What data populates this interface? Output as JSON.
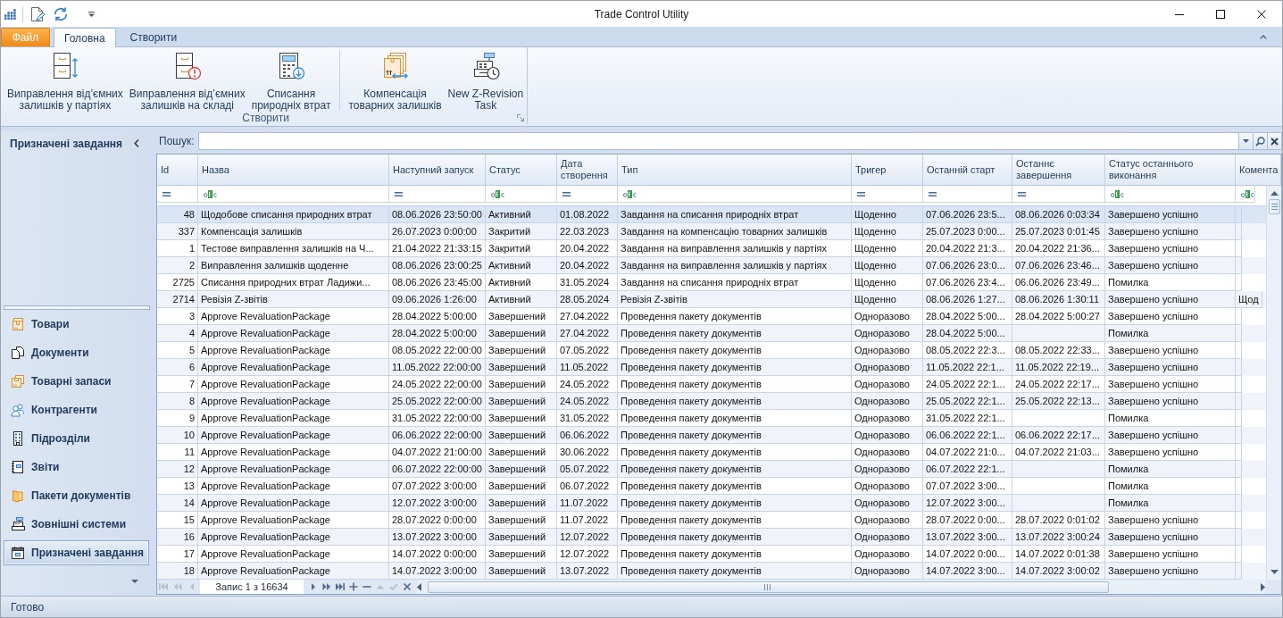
{
  "window": {
    "title": "Trade Control Utility"
  },
  "ribbon": {
    "tabs": [
      {
        "label": "Файл",
        "kind": "menu",
        "selected": false
      },
      {
        "label": "Головна",
        "kind": "tab",
        "selected": true
      },
      {
        "label": "Створити",
        "kind": "tab",
        "selected": false
      }
    ],
    "groups": [
      {
        "label": "Створити",
        "sections": [
          {
            "buttons": [
              {
                "label": "Виправлення відʼємних\nзалишків у партіях"
              },
              {
                "label": "Виправлення відʼємних\nзалишків на складі"
              },
              {
                "label": "Списання\nприродніх втрат"
              }
            ]
          },
          {
            "buttons": [
              {
                "label": "Компенсація\nтоварних залишків"
              },
              {
                "label": "New Z-Revision\nTask"
              }
            ]
          }
        ]
      }
    ]
  },
  "sidebar": {
    "title": "Призначені завдання",
    "items": [
      {
        "label": "Товари",
        "selected": false
      },
      {
        "label": "Документи",
        "selected": false
      },
      {
        "label": "Товарні запаси",
        "selected": false
      },
      {
        "label": "Контрагенти",
        "selected": false
      },
      {
        "label": "Підрозділи",
        "selected": false
      },
      {
        "label": "Звіти",
        "selected": false
      },
      {
        "label": "Пакети документів",
        "selected": false
      },
      {
        "label": "Зовнішні системи",
        "selected": false
      },
      {
        "label": "Призначені завдання",
        "selected": true
      }
    ]
  },
  "search": {
    "label": "Пошук:"
  },
  "table": {
    "columns": [
      {
        "label": "Id",
        "kind": "equals"
      },
      {
        "label": "Назва",
        "kind": "text"
      },
      {
        "label": "Наступний запуск",
        "kind": "equals"
      },
      {
        "label": "Статус",
        "kind": "text"
      },
      {
        "label": "Дата створення",
        "kind": "equals"
      },
      {
        "label": "Тип",
        "kind": "text"
      },
      {
        "label": "Тригер",
        "kind": "equals"
      },
      {
        "label": "Останній старт",
        "kind": "equals"
      },
      {
        "label": "Останнє завершення",
        "kind": "equals"
      },
      {
        "label": "Статус останнього виконання",
        "kind": "text"
      },
      {
        "label": "Комента",
        "kind": "text"
      }
    ],
    "rows": [
      {
        "selected": true,
        "id": "48",
        "name": "Щодобове списання природних втрат",
        "next_run": "08.06.2026 23:50:00",
        "status": "Активний",
        "created": "01.08.2022",
        "type": "Завдання на списання природніх втрат",
        "trigger": "Щоденно",
        "last_start": "07.06.2026 23:5...",
        "last_finish": "08.06.2026 0:03:34",
        "last_run_status": "Завершено успішно"
      },
      {
        "selected": false,
        "id": "337",
        "name": "Компенсація залишків",
        "next_run": "26.07.2023 0:00:00",
        "status": "Закритий",
        "created": "22.03.2023",
        "type": "Завдання на компенсацію товарних залишків",
        "trigger": "Щоденно",
        "last_start": "25.07.2023 0:00...",
        "last_finish": "25.07.2023 0:01:45",
        "last_run_status": "Завершено успішно"
      },
      {
        "selected": false,
        "id": "1",
        "name": "Тестове виправлення залишків на Ч...",
        "next_run": "21.04.2022 21:33:15",
        "status": "Закритий",
        "created": "20.04.2022",
        "type": "Завдання на виправлення залишків у партіях",
        "trigger": "Щоденно",
        "last_start": "20.04.2022 21:3...",
        "last_finish": "20.04.2022 21:36...",
        "last_run_status": "Завершено успішно"
      },
      {
        "selected": false,
        "id": "2",
        "name": "Виправлення залишків щоденне",
        "next_run": "08.06.2026 23:00:25",
        "status": "Активний",
        "created": "20.04.2022",
        "type": "Завдання на виправлення залишків у партіях",
        "trigger": "Щоденно",
        "last_start": "07.06.2026 23:0...",
        "last_finish": "07.06.2026 23:46...",
        "last_run_status": "Завершено успішно"
      },
      {
        "selected": false,
        "id": "2725",
        "name": "Списання природних втрат Ладижи...",
        "next_run": "08.06.2026 23:45:00",
        "status": "Активний",
        "created": "31.05.2024",
        "type": "Завдання на списання природніх втрат",
        "trigger": "Щоденно",
        "last_start": "07.06.2026 23:4...",
        "last_finish": "06.06.2026 23:49...",
        "last_run_status": "Помилка"
      },
      {
        "selected": false,
        "id": "2714",
        "name": "Ревізія Z-звітів",
        "next_run": "09.06.2026 1:26:00",
        "status": "Активний",
        "created": "28.05.2024",
        "type": "Ревізія Z-звітів",
        "trigger": "Щоденно",
        "last_start": "08.06.2026 1:27...",
        "last_finish": "08.06.2026 1:30:11",
        "last_run_status": "Завершено успішно",
        "column_11": "Щод"
      },
      {
        "selected": false,
        "id": "3",
        "name": "Approve RevaluationPackage",
        "next_run": "28.04.2022 5:00:00",
        "status": "Завершений",
        "created": "27.04.2022",
        "type": "Проведення пакету документів",
        "trigger": "Одноразово",
        "last_start": "28.04.2022 5:00...",
        "last_finish": "28.04.2022 5:00:27",
        "last_run_status": "Завершено успішно"
      },
      {
        "selected": false,
        "id": "4",
        "name": "Approve RevaluationPackage",
        "next_run": "28.04.2022 5:00:00",
        "status": "Завершений",
        "created": "27.04.2022",
        "type": "Проведення пакету документів",
        "trigger": "Одноразово",
        "last_start": "28.04.2022 5:00...",
        "last_run_status": "Помилка"
      },
      {
        "selected": false,
        "id": "5",
        "name": "Approve RevaluationPackage",
        "next_run": "08.05.2022 22:00:00",
        "status": "Завершений",
        "created": "07.05.2022",
        "type": "Проведення пакету документів",
        "trigger": "Одноразово",
        "last_start": "08.05.2022 22:3...",
        "last_finish": "08.05.2022 22:33...",
        "last_run_status": "Завершено успішно"
      },
      {
        "selected": false,
        "id": "6",
        "name": "Approve RevaluationPackage",
        "next_run": "11.05.2022 22:00:00",
        "status": "Завершений",
        "created": "11.05.2022",
        "type": "Проведення пакету документів",
        "trigger": "Одноразово",
        "last_start": "11.05.2022 22:1...",
        "last_finish": "11.05.2022 22:19...",
        "last_run_status": "Завершено успішно"
      },
      {
        "selected": false,
        "id": "7",
        "name": "Approve RevaluationPackage",
        "next_run": "24.05.2022 22:00:00",
        "status": "Завершений",
        "created": "24.05.2022",
        "type": "Проведення пакету документів",
        "trigger": "Одноразово",
        "last_start": "24.05.2022 22:1...",
        "last_finish": "24.05.2022 22:17...",
        "last_run_status": "Завершено успішно"
      },
      {
        "selected": false,
        "id": "8",
        "name": "Approve RevaluationPackage",
        "next_run": "25.05.2022 22:00:00",
        "status": "Завершений",
        "created": "24.05.2022",
        "type": "Проведення пакету документів",
        "trigger": "Одноразово",
        "last_start": "25.05.2022 22:1...",
        "last_finish": "25.05.2022 22:13...",
        "last_run_status": "Завершено успішно"
      },
      {
        "selected": false,
        "id": "9",
        "name": "Approve RevaluationPackage",
        "next_run": "31.05.2022 22:00:00",
        "status": "Завершений",
        "created": "31.05.2022",
        "type": "Проведення пакету документів",
        "trigger": "Одноразово",
        "last_start": "31.05.2022 22:1...",
        "last_run_status": "Помилка"
      },
      {
        "selected": false,
        "id": "10",
        "name": "Approve RevaluationPackage",
        "next_run": "06.06.2022 22:00:00",
        "status": "Завершений",
        "created": "06.06.2022",
        "type": "Проведення пакету документів",
        "trigger": "Одноразово",
        "last_start": "06.06.2022 22:1...",
        "last_finish": "06.06.2022 22:17...",
        "last_run_status": "Завершено успішно"
      },
      {
        "selected": false,
        "id": "11",
        "name": "Approve RevaluationPackage",
        "next_run": "04.07.2022 21:00:00",
        "status": "Завершений",
        "created": "30.06.2022",
        "type": "Проведення пакету документів",
        "trigger": "Одноразово",
        "last_start": "04.07.2022 21:0...",
        "last_finish": "04.07.2022 21:03...",
        "last_run_status": "Завершено успішно"
      },
      {
        "selected": false,
        "id": "12",
        "name": "Approve RevaluationPackage",
        "next_run": "06.07.2022 22:00:00",
        "status": "Завершений",
        "created": "05.07.2022",
        "type": "Проведення пакету документів",
        "trigger": "Одноразово",
        "last_start": "06.07.2022 22:1...",
        "last_run_status": "Помилка"
      },
      {
        "selected": false,
        "id": "13",
        "name": "Approve RevaluationPackage",
        "next_run": "07.07.2022 3:00:00",
        "status": "Завершений",
        "created": "06.07.2022",
        "type": "Проведення пакету документів",
        "trigger": "Одноразово",
        "last_start": "07.07.2022 3:00...",
        "last_run_status": "Помилка"
      },
      {
        "selected": false,
        "id": "14",
        "name": "Approve RevaluationPackage",
        "next_run": "12.07.2022 3:00:00",
        "status": "Завершений",
        "created": "11.07.2022",
        "type": "Проведення пакету документів",
        "trigger": "Одноразово",
        "last_start": "12.07.2022 3:00...",
        "last_run_status": "Помилка"
      },
      {
        "selected": false,
        "id": "15",
        "name": "Approve RevaluationPackage",
        "next_run": "28.07.2022 0:00:00",
        "status": "Завершений",
        "created": "11.07.2022",
        "type": "Проведення пакету документів",
        "trigger": "Одноразово",
        "last_start": "28.07.2022 0:00...",
        "last_finish": "28.07.2022 0:01:02",
        "last_run_status": "Завершено успішно"
      },
      {
        "selected": false,
        "id": "16",
        "name": "Approve RevaluationPackage",
        "next_run": "13.07.2022 3:00:00",
        "status": "Завершений",
        "created": "12.07.2022",
        "type": "Проведення пакету документів",
        "trigger": "Одноразово",
        "last_start": "13.07.2022 3:00...",
        "last_finish": "13.07.2022 3:00:24",
        "last_run_status": "Завершено успішно"
      },
      {
        "selected": false,
        "id": "17",
        "name": "Approve RevaluationPackage",
        "next_run": "14.07.2022 0:00:00",
        "status": "Завершений",
        "created": "12.07.2022",
        "type": "Проведення пакету документів",
        "trigger": "Одноразово",
        "last_start": "14.07.2022 0:00...",
        "last_finish": "14.07.2022 0:01:38",
        "last_run_status": "Завершено успішно"
      },
      {
        "selected": false,
        "id": "18",
        "name": "Approve RevaluationPackage",
        "next_run": "14.07.2022 3:00:00",
        "status": "Завершений",
        "created": "13.07.2022",
        "type": "Проведення пакету документів",
        "trigger": "Одноразово",
        "last_start": "14.07.2022 3:00...",
        "last_finish": "14.07.2022 3:00:02",
        "last_run_status": "Завершено успішно"
      }
    ],
    "navigator": {
      "record": "Запис 1 з 16634",
      "left_buttons": [
        {
          "kind": "first",
          "disabled": true
        },
        {
          "kind": "previous_page",
          "disabled": true
        },
        {
          "kind": "previous",
          "disabled": true
        }
      ],
      "right_buttons": [
        {
          "kind": "next",
          "disabled": false
        },
        {
          "kind": "next_page",
          "disabled": false
        },
        {
          "kind": "last",
          "disabled": false
        },
        {
          "kind": "add",
          "disabled": false
        },
        {
          "kind": "remove",
          "disabled": false
        },
        {
          "kind": "edit",
          "disabled": true
        },
        {
          "kind": "end_edit",
          "disabled": true
        },
        {
          "kind": "cancel_edit",
          "disabled": false
        }
      ]
    }
  },
  "status_bar": {
    "text": "Готово"
  }
}
